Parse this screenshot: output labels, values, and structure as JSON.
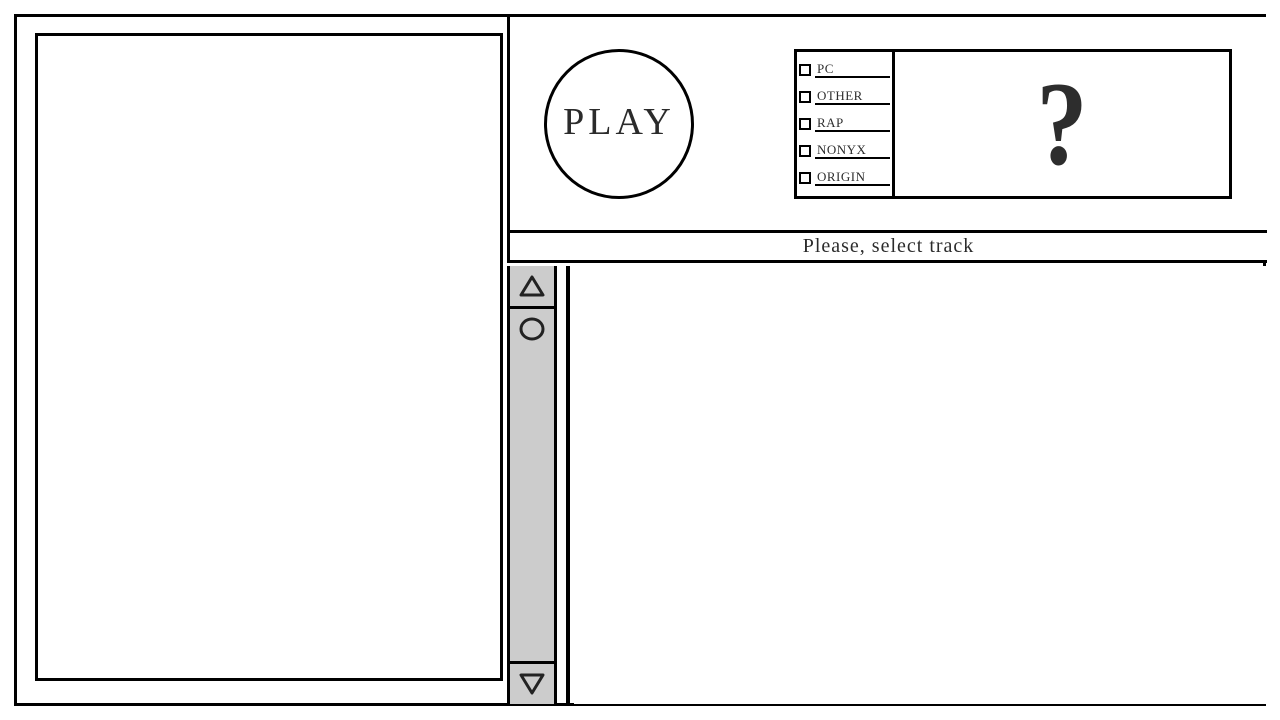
{
  "play": {
    "label": "PLAY"
  },
  "filters": {
    "items": [
      {
        "label": "PC"
      },
      {
        "label": "OTHER"
      },
      {
        "label": "RAP"
      },
      {
        "label": "NONYX"
      },
      {
        "label": "ORIGIN"
      }
    ]
  },
  "help": {
    "glyph": "?"
  },
  "status": {
    "message": "Please, select track"
  }
}
